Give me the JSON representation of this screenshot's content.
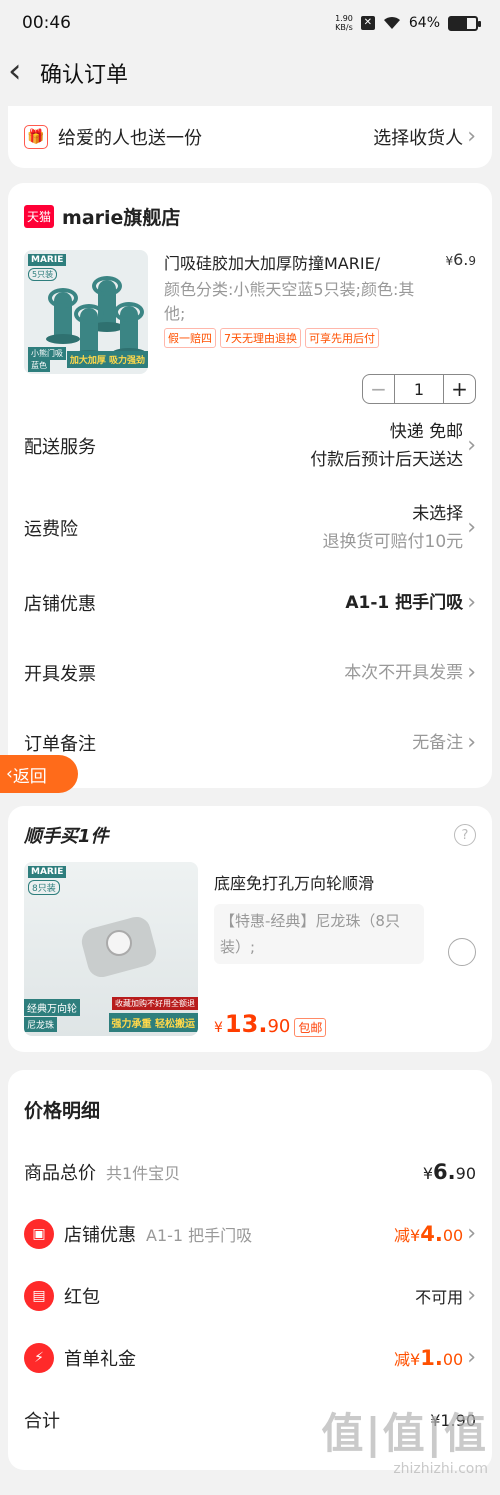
{
  "status": {
    "time": "00:46",
    "speed_value": "1.90",
    "speed_unit": "KB/s",
    "battery": "64%",
    "battery_level": 0.64
  },
  "nav": {
    "title": "确认订单"
  },
  "gift": {
    "label": "给爱的人也送一份",
    "action": "选择收货人"
  },
  "shop": {
    "badge": "天猫",
    "name": "marie旗舰店",
    "product": {
      "brand": "MARIE",
      "count_tag": "5只装",
      "image_label1": "小熊门吸",
      "image_label2": "蓝色",
      "image_tag": "加大加厚 吸力强劲",
      "title": "门吸硅胶加大加厚防撞MARIE/",
      "price_symbol": "¥",
      "price_int": "6.",
      "price_dec": "9",
      "sku": "颜色分类:小熊天空蓝5只装;颜色:其他;",
      "tags": [
        "假一赔四",
        "7天无理由退换",
        "可享先用后付"
      ],
      "quantity": "1",
      "minus": "−",
      "plus": "+"
    },
    "rows": {
      "delivery": {
        "label": "配送服务",
        "value": "快递 免邮",
        "sub": "付款后预计后天送达"
      },
      "insurance": {
        "label": "运费险",
        "value": "未选择",
        "sub": "退换货可赔付10元"
      },
      "discount": {
        "label": "店铺优惠",
        "value": "A1-1 把手门吸"
      },
      "invoice": {
        "label": "开具发票",
        "value": "本次不开具发票"
      },
      "note": {
        "label": "订单备注",
        "value": "无备注"
      }
    }
  },
  "float_back": {
    "label": "返回"
  },
  "addon": {
    "title": "顺手买1件",
    "help": "?",
    "brand": "MARIE",
    "count_tag": "8只装",
    "image_label1": "经典万向轮",
    "image_label2": "尼龙珠",
    "image_tag1": "收藏加购不好用全额退",
    "image_tag2": "强力承重 轻松搬运",
    "name": "底座免打孔万向轮顺滑",
    "sku": "【特惠-经典】尼龙珠（8只装）;",
    "price_symbol": "¥",
    "price_int": "13.",
    "price_dec": "90",
    "shipping": "包邮"
  },
  "price_detail": {
    "title": "价格明细",
    "total": {
      "label": "商品总价",
      "sub": "共1件宝贝",
      "symbol": "¥",
      "int": "6.",
      "dec": "90"
    },
    "shop_discount": {
      "label": "店铺优惠",
      "sub": "A1-1 把手门吸",
      "prefix": "减¥",
      "int": "4.",
      "dec": "00"
    },
    "red_packet": {
      "label": "红包",
      "value": "不可用"
    },
    "first_order": {
      "label": "首单礼金",
      "prefix": "减¥",
      "int": "1.",
      "dec": "00"
    },
    "sum": {
      "label": "合计",
      "value": "¥1.90"
    }
  },
  "watermark": {
    "big": "值|值|值",
    "small": "zhizhizhi.com"
  },
  "colors": {
    "accent": "#ff5000",
    "tmall": "#ff0036",
    "brand_teal": "#2e7e7d",
    "float_button": "#ff6b1a"
  },
  "icons": [
    "back-arrow-icon",
    "gift-icon",
    "chevron-right-icon",
    "help-icon",
    "store-icon",
    "red-packet-icon",
    "lightning-icon",
    "wifi-icon",
    "battery-icon"
  ]
}
